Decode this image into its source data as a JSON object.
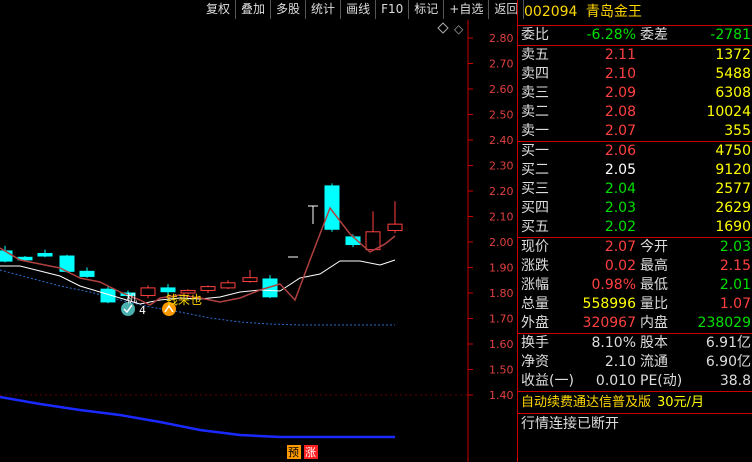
{
  "toolbar": {
    "buttons": [
      "复权",
      "叠加",
      "多股",
      "统计",
      "画线",
      "F10",
      "标记",
      "+自选",
      "返回"
    ]
  },
  "chart": {
    "yticks": [
      "2.80",
      "2.70",
      "2.60",
      "2.50",
      "2.40",
      "2.30",
      "2.20",
      "2.10",
      "2.00",
      "1.90",
      "1.80",
      "1.70",
      "1.60",
      "1.50",
      "1.40"
    ],
    "annotations": {
      "marker_label": "机",
      "marker_count": "4",
      "signal_label": "钱来也"
    },
    "badges": {
      "pre": "预",
      "rise": "涨"
    },
    "colors": {
      "up": "#ff4040",
      "down": "#00ffff",
      "ma": "#ffffff",
      "ma2": "#b04040",
      "volume_line": "#1a2aff",
      "dashed": "#2a6fd0"
    }
  },
  "stock": {
    "code": "002094",
    "name": "青岛金王"
  },
  "order_book": {
    "weibi_label": "委比",
    "weibi_value": "-6.28%",
    "weicha_label": "委差",
    "weicha_value": "-2781",
    "asks": [
      {
        "label": "卖五",
        "price": "2.11",
        "volume": "1372"
      },
      {
        "label": "卖四",
        "price": "2.10",
        "volume": "5488"
      },
      {
        "label": "卖三",
        "price": "2.09",
        "volume": "6308"
      },
      {
        "label": "卖二",
        "price": "2.08",
        "volume": "10024"
      },
      {
        "label": "卖一",
        "price": "2.07",
        "volume": "355"
      }
    ],
    "bids": [
      {
        "label": "买一",
        "price": "2.06",
        "volume": "4750"
      },
      {
        "label": "买二",
        "price": "2.05",
        "volume": "9120"
      },
      {
        "label": "买三",
        "price": "2.04",
        "volume": "2577"
      },
      {
        "label": "买四",
        "price": "2.03",
        "volume": "2629"
      },
      {
        "label": "买五",
        "price": "2.02",
        "volume": "1690"
      }
    ]
  },
  "quote": {
    "rows": [
      {
        "l1": "现价",
        "v1": "2.07",
        "l2": "今开",
        "v2": "2.03"
      },
      {
        "l1": "涨跌",
        "v1": "0.02",
        "l2": "最高",
        "v2": "2.15"
      },
      {
        "l1": "涨幅",
        "v1": "0.98%",
        "l2": "最低",
        "v2": "2.01"
      },
      {
        "l1": "总量",
        "v1": "558996",
        "l2": "量比",
        "v2": "1.07"
      },
      {
        "l1": "外盘",
        "v1": "320967",
        "l2": "内盘",
        "v2": "238029"
      }
    ]
  },
  "fundamentals": {
    "rows": [
      {
        "l1": "换手",
        "v1": "8.10%",
        "l2": "股本",
        "v2": "6.91亿"
      },
      {
        "l1": "净资",
        "v1": "2.10",
        "l2": "流通",
        "v2": "6.90亿"
      },
      {
        "l1": "收益(一)",
        "v1": "0.010",
        "l2": "PE(动)",
        "v2": "38.8"
      }
    ]
  },
  "ad": {
    "text": "自动续费通达信普及版",
    "price": "30元/月"
  },
  "status": {
    "connection": "行情连接已断开"
  }
}
